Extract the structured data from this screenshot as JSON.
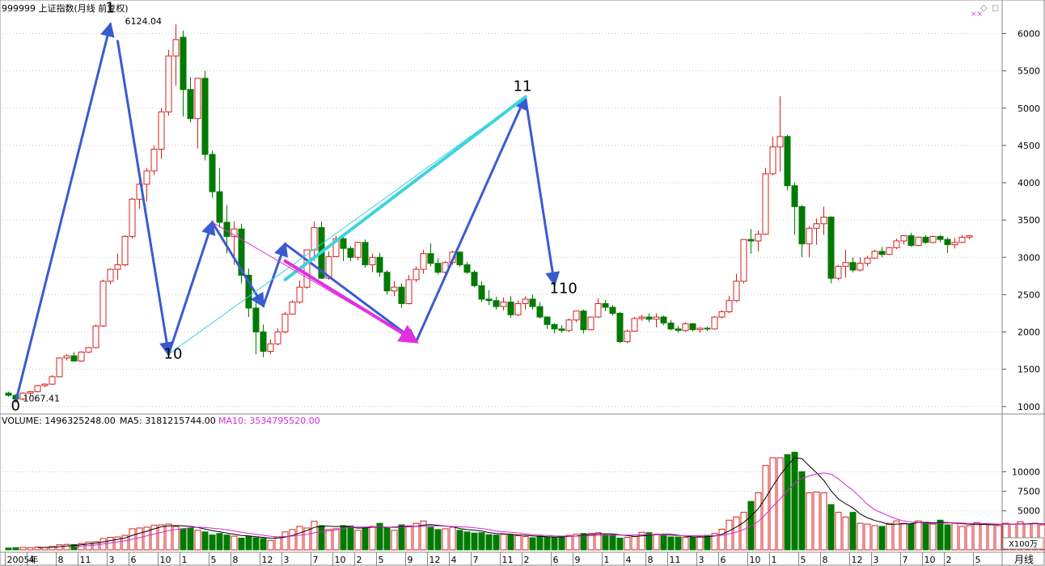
{
  "header": {
    "title": "999999 上证指数(月线 前复权)",
    "close_icons": [
      "◇",
      "◻"
    ],
    "pink_marks": "××"
  },
  "volume_header": {
    "volume_label": "VOLUME: 1496325248.00",
    "ma5_label": "MA5: 3181215744.00",
    "ma10_label": "MA10: 3534795520.00"
  },
  "colors": {
    "up": "#d42020",
    "down": "#007a00",
    "wave_blue": "#3a5bd0",
    "cyan": "#3dd3dc",
    "magenta": "#e030e0",
    "ma5": "#000000",
    "ma10": "#d22bd2",
    "grid": "#c8c8c8"
  },
  "chart_data": {
    "type": "candlestick",
    "title": "999999 上证指数(月线 前复权)",
    "price_axis": {
      "ticks": [
        1000,
        1500,
        2000,
        2500,
        3000,
        3500,
        4000,
        4500,
        5000,
        5500,
        6000
      ],
      "range": [
        900,
        6450
      ]
    },
    "volume_axis": {
      "ticks": [
        5000,
        7500,
        10000
      ],
      "unit": "X100万",
      "range": [
        0,
        14500
      ]
    },
    "x_labels": [
      {
        "i": 0,
        "t": "2005年"
      },
      {
        "i": 3,
        "t": "4"
      },
      {
        "i": 7,
        "t": "8"
      },
      {
        "i": 10,
        "t": "11"
      },
      {
        "i": 14,
        "t": "3"
      },
      {
        "i": 17,
        "t": "6"
      },
      {
        "i": 21,
        "t": "10"
      },
      {
        "i": 24,
        "t": "1"
      },
      {
        "i": 28,
        "t": "5"
      },
      {
        "i": 31,
        "t": "8"
      },
      {
        "i": 35,
        "t": "12"
      },
      {
        "i": 38,
        "t": "3"
      },
      {
        "i": 42,
        "t": "7"
      },
      {
        "i": 45,
        "t": "10"
      },
      {
        "i": 48,
        "t": "2"
      },
      {
        "i": 51,
        "t": "5"
      },
      {
        "i": 55,
        "t": "9"
      },
      {
        "i": 58,
        "t": "12"
      },
      {
        "i": 61,
        "t": "4"
      },
      {
        "i": 64,
        "t": "7"
      },
      {
        "i": 68,
        "t": "11"
      },
      {
        "i": 71,
        "t": "2"
      },
      {
        "i": 75,
        "t": "6"
      },
      {
        "i": 78,
        "t": "9"
      },
      {
        "i": 82,
        "t": "1"
      },
      {
        "i": 85,
        "t": "4"
      },
      {
        "i": 88,
        "t": "8"
      },
      {
        "i": 91,
        "t": "11"
      },
      {
        "i": 95,
        "t": "3"
      },
      {
        "i": 98,
        "t": "6"
      },
      {
        "i": 102,
        "t": "10"
      },
      {
        "i": 105,
        "t": "1"
      },
      {
        "i": 109,
        "t": "5"
      },
      {
        "i": 112,
        "t": "8"
      },
      {
        "i": 116,
        "t": "12"
      },
      {
        "i": 119,
        "t": "3"
      },
      {
        "i": 123,
        "t": "7"
      },
      {
        "i": 126,
        "t": "10"
      },
      {
        "i": 129,
        "t": "2"
      },
      {
        "i": 133,
        "t": "5"
      }
    ],
    "bottom_right_label": "月线",
    "annotations": [
      {
        "type": "text",
        "text": "1",
        "i": 14,
        "v": 6280
      },
      {
        "type": "text",
        "text": "6124.04",
        "i": 16,
        "v": 6124
      },
      {
        "type": "text",
        "text": "0",
        "i": 1,
        "v": 950
      },
      {
        "type": "text",
        "text": "1067.41",
        "i": 2,
        "v": 1067
      },
      {
        "type": "text",
        "text": "10",
        "i": 22,
        "v": 1640
      },
      {
        "type": "text",
        "text": "11",
        "i": 70,
        "v": 5230
      },
      {
        "type": "text",
        "text": "110",
        "i": 75,
        "v": 2520
      }
    ],
    "wave_lines": [
      {
        "from": [
          1,
          1067
        ],
        "to": [
          14,
          6124
        ],
        "color": "wave_blue",
        "w": 3,
        "arrow": true
      },
      {
        "from": [
          15,
          5900
        ],
        "to": [
          22,
          1700
        ],
        "color": "wave_blue",
        "w": 3,
        "arrow": true
      },
      {
        "from": [
          22,
          1700
        ],
        "to": [
          28,
          3470
        ],
        "color": "wave_blue",
        "w": 3,
        "arrow": true
      },
      {
        "from": [
          28,
          3470
        ],
        "to": [
          35,
          2350
        ],
        "color": "wave_blue",
        "w": 3,
        "arrow": true
      },
      {
        "from": [
          35,
          2350
        ],
        "to": [
          38,
          3180
        ],
        "color": "wave_blue",
        "w": 3,
        "arrow": true
      },
      {
        "from": [
          38,
          3180
        ],
        "to": [
          56,
          1870
        ],
        "color": "wave_blue",
        "w": 3,
        "arrow": true
      },
      {
        "from": [
          56,
          1870
        ],
        "to": [
          71,
          5150
        ],
        "color": "wave_blue",
        "w": 3,
        "arrow": true
      },
      {
        "from": [
          71,
          5150
        ],
        "to": [
          75,
          2640
        ],
        "color": "wave_blue",
        "w": 3,
        "arrow": true
      },
      {
        "from": [
          22,
          1700
        ],
        "to": [
          71,
          5150
        ],
        "color": "cyan",
        "w": 1,
        "arrow": false
      },
      {
        "from": [
          38,
          2700
        ],
        "to": [
          71,
          5150
        ],
        "color": "cyan",
        "w": 4,
        "arrow": false
      },
      {
        "from": [
          28,
          3470
        ],
        "to": [
          56,
          1870
        ],
        "color": "magenta",
        "w": 1,
        "arrow": false
      },
      {
        "from": [
          38,
          2950
        ],
        "to": [
          56,
          1870
        ],
        "color": "magenta",
        "w": 4,
        "arrow": true
      }
    ],
    "candles": [
      [
        1180,
        1200,
        1130,
        1150
      ],
      [
        1150,
        1170,
        1090,
        1100
      ],
      [
        1100,
        1190,
        1080,
        1180
      ],
      [
        1180,
        1210,
        1140,
        1200
      ],
      [
        1200,
        1290,
        1190,
        1280
      ],
      [
        1280,
        1310,
        1260,
        1300
      ],
      [
        1300,
        1420,
        1290,
        1400
      ],
      [
        1400,
        1660,
        1390,
        1650
      ],
      [
        1650,
        1700,
        1620,
        1680
      ],
      [
        1680,
        1730,
        1600,
        1610
      ],
      [
        1610,
        1740,
        1600,
        1730
      ],
      [
        1730,
        1800,
        1720,
        1790
      ],
      [
        1790,
        2100,
        1780,
        2080
      ],
      [
        2080,
        2700,
        2070,
        2680
      ],
      [
        2680,
        2850,
        2640,
        2840
      ],
      [
        2840,
        3050,
        2700,
        2900
      ],
      [
        2900,
        3300,
        2880,
        3280
      ],
      [
        3280,
        3800,
        3250,
        3780
      ],
      [
        3780,
        4170,
        3650,
        3980
      ],
      [
        3980,
        4200,
        3750,
        4160
      ],
      [
        4160,
        4500,
        4100,
        4450
      ],
      [
        4450,
        5000,
        4320,
        4950
      ],
      [
        4950,
        5780,
        4900,
        5700
      ],
      [
        5700,
        6124,
        5300,
        5920
      ],
      [
        5950,
        6040,
        4890,
        5250
      ],
      [
        5250,
        5420,
        4810,
        4860
      ],
      [
        4860,
        5400,
        4460,
        5400
      ],
      [
        5400,
        5500,
        4300,
        4380
      ],
      [
        4380,
        4430,
        3800,
        3880
      ],
      [
        3880,
        4200,
        3400,
        3470
      ],
      [
        3470,
        3700,
        3050,
        3280
      ],
      [
        3280,
        3480,
        2900,
        3380
      ],
      [
        3380,
        3450,
        2650,
        2760
      ],
      [
        2760,
        2850,
        2200,
        2320
      ],
      [
        2320,
        2420,
        1700,
        2000
      ],
      [
        2000,
        2100,
        1660,
        1740
      ],
      [
        1740,
        1900,
        1700,
        1840
      ],
      [
        1840,
        2050,
        1820,
        2000
      ],
      [
        2000,
        2270,
        1980,
        2240
      ],
      [
        2240,
        2420,
        2230,
        2400
      ],
      [
        2400,
        2690,
        2380,
        2600
      ],
      [
        2600,
        3100,
        2580,
        3100
      ],
      [
        3100,
        3480,
        2950,
        3400
      ],
      [
        3400,
        3480,
        2710,
        2720
      ],
      [
        2720,
        3080,
        2700,
        3010
      ],
      [
        3010,
        3290,
        3000,
        3250
      ],
      [
        3250,
        3300,
        2950,
        3120
      ],
      [
        3120,
        3150,
        2950,
        3000
      ],
      [
        3000,
        3210,
        2960,
        3200
      ],
      [
        3200,
        3240,
        2860,
        2900
      ],
      [
        2900,
        3050,
        2800,
        3000
      ],
      [
        3000,
        3060,
        2740,
        2800
      ],
      [
        2800,
        2830,
        2500,
        2550
      ],
      [
        2550,
        2680,
        2480,
        2600
      ],
      [
        2600,
        2650,
        2320,
        2380
      ],
      [
        2380,
        2760,
        2370,
        2700
      ],
      [
        2700,
        2880,
        2670,
        2840
      ],
      [
        2840,
        3100,
        2780,
        3050
      ],
      [
        3050,
        3190,
        2880,
        2920
      ],
      [
        2920,
        2990,
        2770,
        2800
      ],
      [
        2800,
        2950,
        2780,
        2930
      ],
      [
        2930,
        3090,
        2900,
        3070
      ],
      [
        3070,
        3080,
        2870,
        2900
      ],
      [
        2900,
        2940,
        2780,
        2800
      ],
      [
        2800,
        2830,
        2600,
        2620
      ],
      [
        2620,
        2680,
        2400,
        2440
      ],
      [
        2440,
        2560,
        2360,
        2420
      ],
      [
        2420,
        2470,
        2300,
        2340
      ],
      [
        2340,
        2460,
        2290,
        2400
      ],
      [
        2400,
        2480,
        2190,
        2230
      ],
      [
        2230,
        2420,
        2210,
        2380
      ],
      [
        2380,
        2480,
        2300,
        2440
      ],
      [
        2440,
        2500,
        2300,
        2340
      ],
      [
        2340,
        2400,
        2180,
        2200
      ],
      [
        2200,
        2210,
        2040,
        2100
      ],
      [
        2100,
        2120,
        1980,
        2040
      ],
      [
        2040,
        2090,
        1990,
        2020
      ],
      [
        2020,
        2180,
        2000,
        2160
      ],
      [
        2160,
        2280,
        2130,
        2280
      ],
      [
        2280,
        2300,
        1980,
        2030
      ],
      [
        2030,
        2210,
        2020,
        2200
      ],
      [
        2200,
        2450,
        2190,
        2380
      ],
      [
        2380,
        2430,
        2280,
        2330
      ],
      [
        2330,
        2360,
        2220,
        2250
      ],
      [
        2250,
        2270,
        1850,
        1870
      ],
      [
        1870,
        2030,
        1850,
        2010
      ],
      [
        2010,
        2200,
        2000,
        2180
      ],
      [
        2180,
        2230,
        2150,
        2200
      ],
      [
        2200,
        2250,
        2130,
        2170
      ],
      [
        2170,
        2250,
        2060,
        2200
      ],
      [
        2200,
        2220,
        2090,
        2120
      ],
      [
        2120,
        2160,
        2020,
        2040
      ],
      [
        2040,
        2080,
        1990,
        2020
      ],
      [
        2020,
        2130,
        2000,
        2110
      ],
      [
        2110,
        2120,
        2010,
        2030
      ],
      [
        2030,
        2060,
        1990,
        2050
      ],
      [
        2050,
        2070,
        2010,
        2040
      ],
      [
        2040,
        2210,
        2030,
        2200
      ],
      [
        2200,
        2290,
        2180,
        2270
      ],
      [
        2270,
        2480,
        2250,
        2420
      ],
      [
        2420,
        2780,
        2400,
        2680
      ],
      [
        2680,
        3240,
        2650,
        3240
      ],
      [
        3240,
        3380,
        3050,
        3220
      ],
      [
        3220,
        3360,
        3080,
        3310
      ],
      [
        3310,
        4200,
        3300,
        4120
      ],
      [
        4120,
        4620,
        4100,
        4480
      ],
      [
        4480,
        5160,
        4150,
        4620
      ],
      [
        4620,
        4640,
        3900,
        3960
      ],
      [
        3960,
        4000,
        3300,
        3680
      ],
      [
        3680,
        3700,
        3000,
        3180
      ],
      [
        3180,
        3420,
        3000,
        3390
      ],
      [
        3390,
        3520,
        3170,
        3450
      ],
      [
        3450,
        3680,
        3300,
        3540
      ],
      [
        3540,
        3550,
        2650,
        2720
      ],
      [
        2720,
        2900,
        2690,
        2880
      ],
      [
        2880,
        3100,
        2730,
        2930
      ],
      [
        2930,
        3000,
        2800,
        2830
      ],
      [
        2830,
        3000,
        2810,
        2920
      ],
      [
        2920,
        3020,
        2880,
        2990
      ],
      [
        2990,
        3100,
        2980,
        3080
      ],
      [
        3080,
        3140,
        3000,
        3040
      ],
      [
        3040,
        3140,
        3030,
        3130
      ],
      [
        3130,
        3250,
        3110,
        3220
      ],
      [
        3220,
        3300,
        3170,
        3290
      ],
      [
        3290,
        3330,
        3140,
        3160
      ],
      [
        3160,
        3280,
        3150,
        3270
      ],
      [
        3270,
        3300,
        3180,
        3200
      ],
      [
        3200,
        3290,
        3190,
        3280
      ],
      [
        3280,
        3300,
        3200,
        3240
      ],
      [
        3240,
        3260,
        3060,
        3170
      ],
      [
        3170,
        3260,
        3120,
        3200
      ],
      [
        3200,
        3300,
        3190,
        3270
      ],
      [
        3270,
        3300,
        3240,
        3290
      ]
    ],
    "volumes": [
      230,
      280,
      310,
      290,
      350,
      300,
      420,
      650,
      700,
      680,
      820,
      1000,
      1050,
      1450,
      1600,
      1650,
      1850,
      2700,
      2800,
      2900,
      3150,
      3200,
      3300,
      3000,
      2700,
      2800,
      2500,
      2300,
      1900,
      2100,
      1900,
      1750,
      1500,
      1700,
      1550,
      1450,
      1200,
      1650,
      2300,
      2600,
      3000,
      2800,
      3650,
      3100,
      2600,
      2700,
      3100,
      3050,
      2500,
      2800,
      3000,
      3400,
      2800,
      2500,
      3200,
      3050,
      3400,
      3700,
      2900,
      2600,
      2700,
      2900,
      2500,
      2300,
      2150,
      2200,
      1950,
      1900,
      2000,
      1900,
      1800,
      1700,
      1550,
      1750,
      1650,
      1600,
      1750,
      1850,
      2000,
      2100,
      2100,
      2200,
      1900,
      1900,
      1500,
      1600,
      1700,
      2250,
      2200,
      2000,
      1850,
      1650,
      1650,
      1600,
      1600,
      1700,
      1850,
      2100,
      2650,
      3800,
      4200,
      4800,
      6200,
      7300,
      10800,
      11800,
      11800,
      12200,
      12500,
      10000,
      7300,
      7400,
      7300,
      5800,
      4800,
      4200,
      4800,
      3400,
      3300,
      3100,
      3000,
      3400,
      3700,
      3400,
      3300,
      3700,
      3500,
      3300,
      3800,
      3200,
      3400,
      3000,
      3100,
      3500,
      3300,
      3200,
      3100,
      3400,
      3300,
      3600,
      3300,
      3400,
      3200,
      3100,
      1500
    ]
  }
}
